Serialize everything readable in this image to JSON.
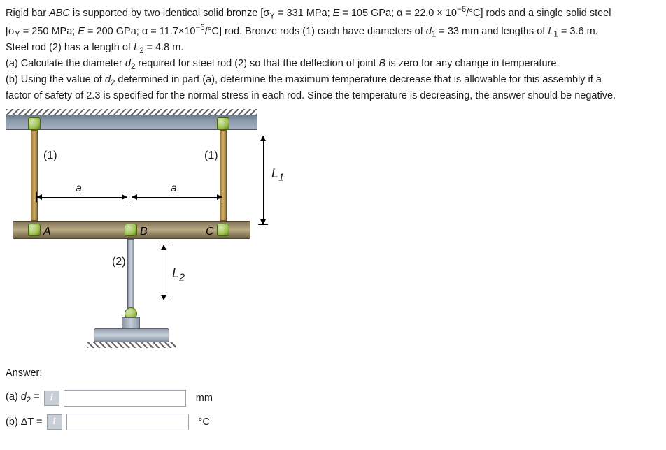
{
  "problem": {
    "line1_pre": "Rigid bar ",
    "line1_abc": "ABC",
    "line1_post": " is supported by two identical solid bronze [σ",
    "line1_y": "Y",
    "line1_post2": " = 331 MPa; ",
    "line1_E": "E",
    "line1_post3": " = 105 GPa; α = 22.0 × 10",
    "line1_exp": "−6",
    "line1_post4": "/°C] rods and a single solid steel",
    "line2_pre": "[σ",
    "line2_y": "Y",
    "line2_post": " = 250 MPa; ",
    "line2_E": "E",
    "line2_post2": " = 200 GPa; α = 11.7×10",
    "line2_exp": "−6",
    "line2_post3": "/°C] rod.  Bronze rods (1) each have diameters of ",
    "line2_d1": "d",
    "line2_sub1": "1",
    "line2_post4": " = 33 mm and lengths of ",
    "line2_L1": "L",
    "line2_subL1": "1",
    "line2_post5": " = 3.6 m.",
    "line3_pre": "Steel rod (2) has a length of ",
    "line3_L2": "L",
    "line3_subL2": "2",
    "line3_post": " = 4.8 m.",
    "part_a_pre": "(a) Calculate the diameter ",
    "part_a_d2": "d",
    "part_a_sub2": "2",
    "part_a_post": " required for steel rod (2) so that the deflection of joint ",
    "part_a_B": "B",
    "part_a_post2": " is zero for any change in temperature.",
    "part_b_pre": "(b) Using the value of ",
    "part_b_d2": "d",
    "part_b_sub2": "2",
    "part_b_post": " determined in part (a), determine the maximum temperature decrease that is allowable for this assembly if a",
    "part_b_line2": "factor of safety of 2.3 is specified for the normal stress in each rod. Since the temperature is decreasing, the answer should be negative."
  },
  "figure": {
    "rod1_left": "(1)",
    "rod1_right": "(1)",
    "rod2": "(2)",
    "a_left": "a",
    "a_right": "a",
    "A": "A",
    "B": "B",
    "C": "C",
    "L1": "L",
    "L1_sub": "1",
    "L2": "L",
    "L2_sub": "2"
  },
  "answer": {
    "heading": "Answer:",
    "a_label_pre": "(a) ",
    "a_d": "d",
    "a_sub": "2",
    "a_eq": " = ",
    "a_unit": "mm",
    "a_value": "",
    "b_label": "(b) ΔT = ",
    "b_unit": "°C",
    "b_value": "",
    "info": "i"
  }
}
